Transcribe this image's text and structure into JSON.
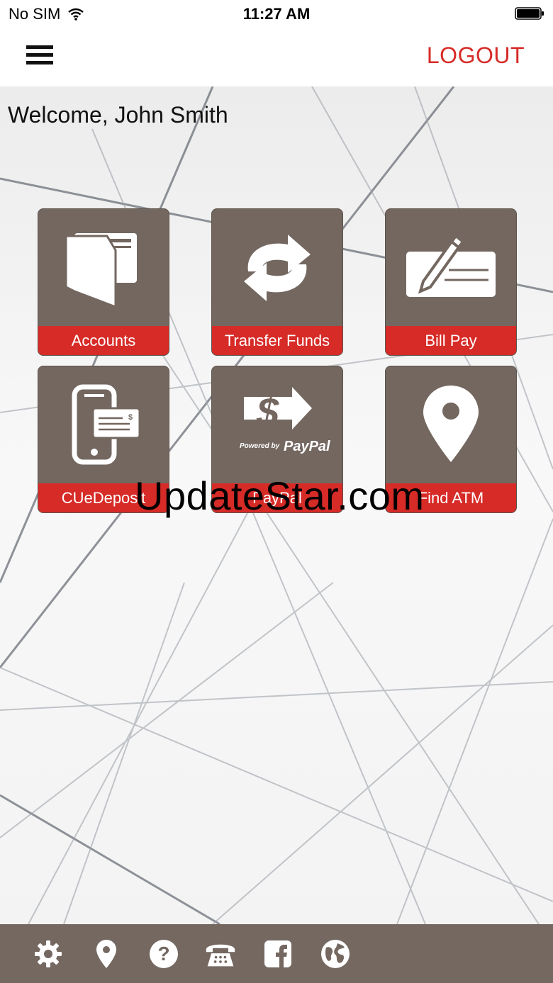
{
  "status_bar": {
    "carrier": "No SIM",
    "time": "11:27 AM"
  },
  "nav": {
    "logout_label": "LOGOUT"
  },
  "welcome": "Welcome, John Smith",
  "tiles": [
    {
      "label": "Accounts",
      "icon": "wallet-icon"
    },
    {
      "label": "Transfer Funds",
      "icon": "transfer-arrows-icon"
    },
    {
      "label": "Bill Pay",
      "icon": "check-pen-icon"
    },
    {
      "label": "CUeDeposit",
      "icon": "mobile-deposit-icon"
    },
    {
      "label": "PayPal",
      "icon": "paypal-icon",
      "badge_text": "Powered by",
      "badge_brand": "PayPal"
    },
    {
      "label": "Find ATM",
      "icon": "map-pin-icon"
    }
  ],
  "watermark": "UpdateStar.com",
  "footer": {
    "icons": [
      "gear-icon",
      "location-icon",
      "help-icon",
      "phone-icon",
      "facebook-icon",
      "globe-icon"
    ]
  },
  "colors": {
    "accent_red": "#d62b27",
    "tile_brown": "#736760",
    "footer_brown": "#746861"
  }
}
